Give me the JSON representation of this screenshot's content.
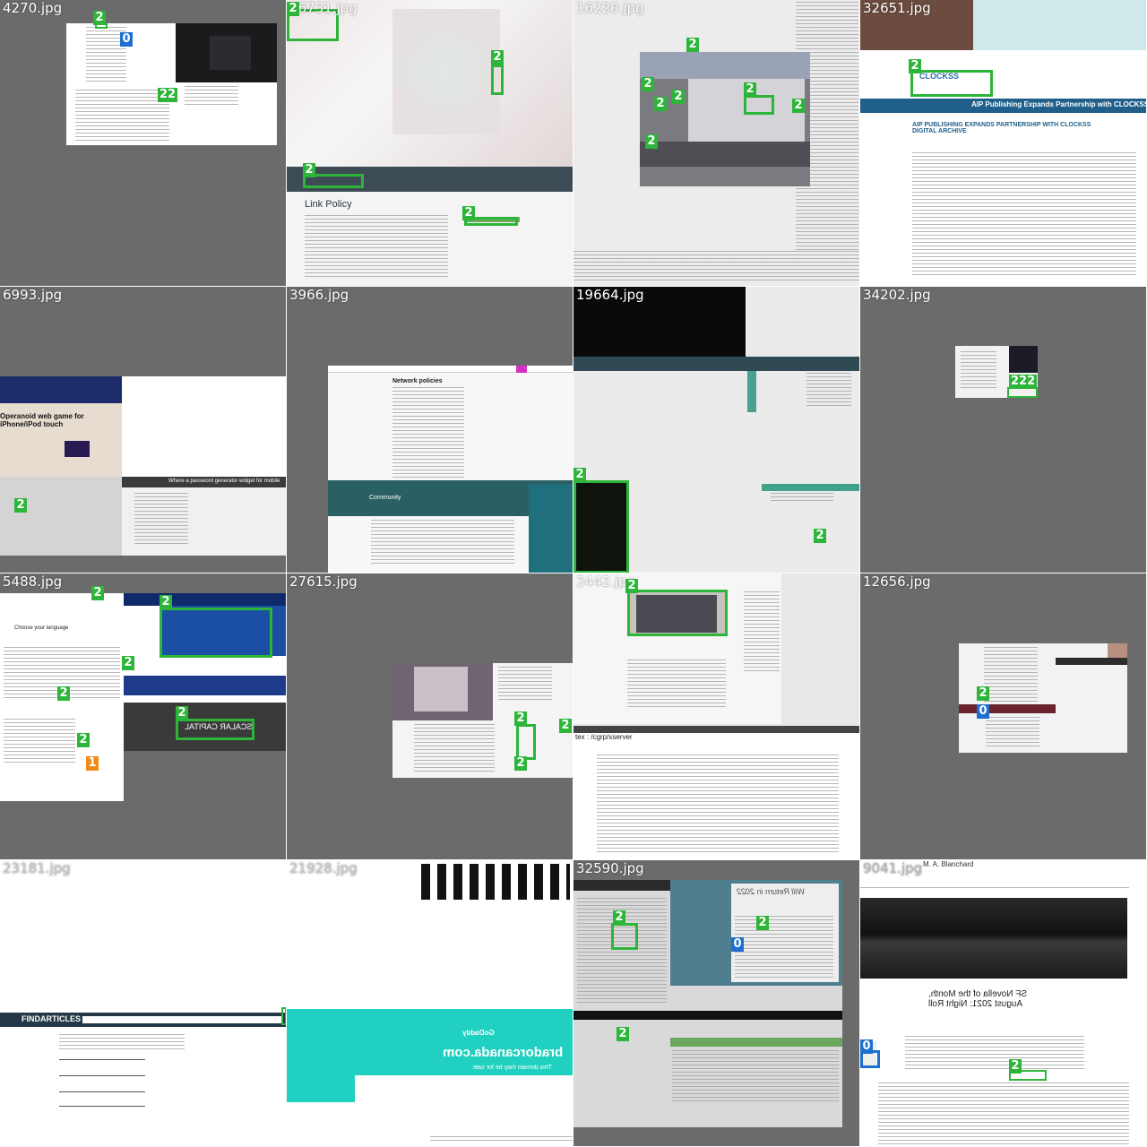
{
  "tiles": [
    {
      "filename": "4270.jpg"
    },
    {
      "filename": "26731.jpg"
    },
    {
      "filename": "16220.jpg"
    },
    {
      "filename": "32651.jpg",
      "heading": "AIP PUBLISHING EXPANDS PARTNERSHIP WITH CLOCKSS DIGITAL ARCHIVE",
      "banner": "AIP Publishing Expands Partnership with CLOCKSS Digital Archive",
      "logo": "CLOCKSS"
    },
    {
      "filename": "6993.jpg",
      "heading": "Operanoid web game for iPhone/iPod touch",
      "widget": "Where a password generator widget for mobile"
    },
    {
      "filename": "3966.jpg",
      "heading": "Network policies",
      "community": "Community"
    },
    {
      "filename": "19664.jpg"
    },
    {
      "filename": "34202.jpg"
    },
    {
      "filename": "5488.jpg",
      "heading": "Choose your language",
      "brand": "SCALAR CAPITAL"
    },
    {
      "filename": "27615.jpg"
    },
    {
      "filename": "3442.jpg",
      "terminal": "tex : /cgrp/xserver"
    },
    {
      "filename": "12656.jpg"
    },
    {
      "filename": "23181.jpg",
      "brand": "FINDARTICLES"
    },
    {
      "filename": "21928.jpg",
      "domain": "bradorcanada.com",
      "sub": "This domain may be for sale.",
      "registrar": "GoDaddy"
    },
    {
      "filename": "32590.jpg",
      "heading": "Will Return in 2022"
    },
    {
      "filename": "9041.jpg",
      "author": "M. A. Blanchard",
      "post_title": "SF Novella of the Month, August 2021: Night Roll"
    }
  ],
  "annotation_labels": {
    "two": "2",
    "one": "1",
    "zero": "0",
    "twentytwo": "22",
    "twotwotwo": "222"
  },
  "colors": {
    "box_green": "#2db53a",
    "box_orange": "#f08a18",
    "badge_blue": "#1e6fd0",
    "tile_gray": "#6b6b6b"
  }
}
